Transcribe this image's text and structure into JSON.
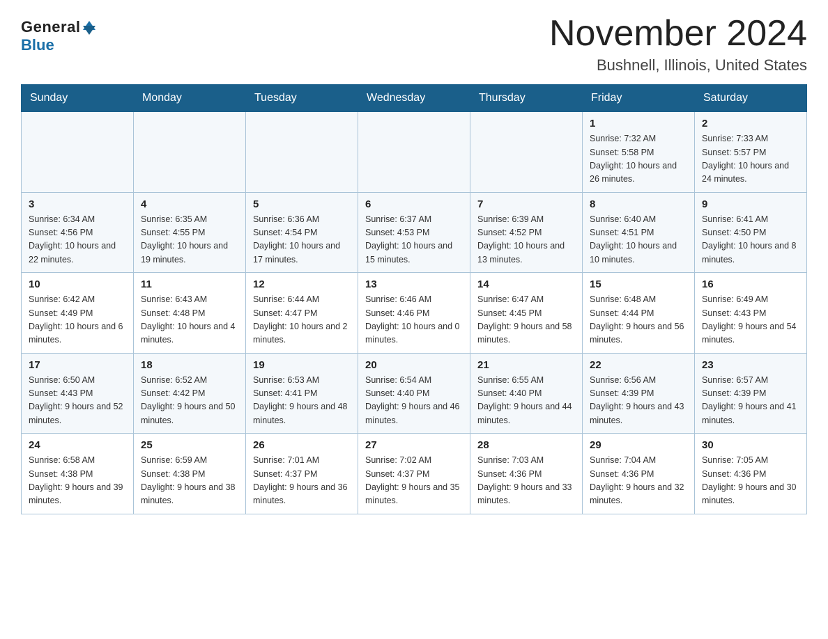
{
  "logo": {
    "general": "General",
    "blue": "Blue"
  },
  "title": "November 2024",
  "location": "Bushnell, Illinois, United States",
  "weekdays": [
    "Sunday",
    "Monday",
    "Tuesday",
    "Wednesday",
    "Thursday",
    "Friday",
    "Saturday"
  ],
  "weeks": [
    [
      {
        "day": "",
        "info": ""
      },
      {
        "day": "",
        "info": ""
      },
      {
        "day": "",
        "info": ""
      },
      {
        "day": "",
        "info": ""
      },
      {
        "day": "",
        "info": ""
      },
      {
        "day": "1",
        "info": "Sunrise: 7:32 AM\nSunset: 5:58 PM\nDaylight: 10 hours and 26 minutes."
      },
      {
        "day": "2",
        "info": "Sunrise: 7:33 AM\nSunset: 5:57 PM\nDaylight: 10 hours and 24 minutes."
      }
    ],
    [
      {
        "day": "3",
        "info": "Sunrise: 6:34 AM\nSunset: 4:56 PM\nDaylight: 10 hours and 22 minutes."
      },
      {
        "day": "4",
        "info": "Sunrise: 6:35 AM\nSunset: 4:55 PM\nDaylight: 10 hours and 19 minutes."
      },
      {
        "day": "5",
        "info": "Sunrise: 6:36 AM\nSunset: 4:54 PM\nDaylight: 10 hours and 17 minutes."
      },
      {
        "day": "6",
        "info": "Sunrise: 6:37 AM\nSunset: 4:53 PM\nDaylight: 10 hours and 15 minutes."
      },
      {
        "day": "7",
        "info": "Sunrise: 6:39 AM\nSunset: 4:52 PM\nDaylight: 10 hours and 13 minutes."
      },
      {
        "day": "8",
        "info": "Sunrise: 6:40 AM\nSunset: 4:51 PM\nDaylight: 10 hours and 10 minutes."
      },
      {
        "day": "9",
        "info": "Sunrise: 6:41 AM\nSunset: 4:50 PM\nDaylight: 10 hours and 8 minutes."
      }
    ],
    [
      {
        "day": "10",
        "info": "Sunrise: 6:42 AM\nSunset: 4:49 PM\nDaylight: 10 hours and 6 minutes."
      },
      {
        "day": "11",
        "info": "Sunrise: 6:43 AM\nSunset: 4:48 PM\nDaylight: 10 hours and 4 minutes."
      },
      {
        "day": "12",
        "info": "Sunrise: 6:44 AM\nSunset: 4:47 PM\nDaylight: 10 hours and 2 minutes."
      },
      {
        "day": "13",
        "info": "Sunrise: 6:46 AM\nSunset: 4:46 PM\nDaylight: 10 hours and 0 minutes."
      },
      {
        "day": "14",
        "info": "Sunrise: 6:47 AM\nSunset: 4:45 PM\nDaylight: 9 hours and 58 minutes."
      },
      {
        "day": "15",
        "info": "Sunrise: 6:48 AM\nSunset: 4:44 PM\nDaylight: 9 hours and 56 minutes."
      },
      {
        "day": "16",
        "info": "Sunrise: 6:49 AM\nSunset: 4:43 PM\nDaylight: 9 hours and 54 minutes."
      }
    ],
    [
      {
        "day": "17",
        "info": "Sunrise: 6:50 AM\nSunset: 4:43 PM\nDaylight: 9 hours and 52 minutes."
      },
      {
        "day": "18",
        "info": "Sunrise: 6:52 AM\nSunset: 4:42 PM\nDaylight: 9 hours and 50 minutes."
      },
      {
        "day": "19",
        "info": "Sunrise: 6:53 AM\nSunset: 4:41 PM\nDaylight: 9 hours and 48 minutes."
      },
      {
        "day": "20",
        "info": "Sunrise: 6:54 AM\nSunset: 4:40 PM\nDaylight: 9 hours and 46 minutes."
      },
      {
        "day": "21",
        "info": "Sunrise: 6:55 AM\nSunset: 4:40 PM\nDaylight: 9 hours and 44 minutes."
      },
      {
        "day": "22",
        "info": "Sunrise: 6:56 AM\nSunset: 4:39 PM\nDaylight: 9 hours and 43 minutes."
      },
      {
        "day": "23",
        "info": "Sunrise: 6:57 AM\nSunset: 4:39 PM\nDaylight: 9 hours and 41 minutes."
      }
    ],
    [
      {
        "day": "24",
        "info": "Sunrise: 6:58 AM\nSunset: 4:38 PM\nDaylight: 9 hours and 39 minutes."
      },
      {
        "day": "25",
        "info": "Sunrise: 6:59 AM\nSunset: 4:38 PM\nDaylight: 9 hours and 38 minutes."
      },
      {
        "day": "26",
        "info": "Sunrise: 7:01 AM\nSunset: 4:37 PM\nDaylight: 9 hours and 36 minutes."
      },
      {
        "day": "27",
        "info": "Sunrise: 7:02 AM\nSunset: 4:37 PM\nDaylight: 9 hours and 35 minutes."
      },
      {
        "day": "28",
        "info": "Sunrise: 7:03 AM\nSunset: 4:36 PM\nDaylight: 9 hours and 33 minutes."
      },
      {
        "day": "29",
        "info": "Sunrise: 7:04 AM\nSunset: 4:36 PM\nDaylight: 9 hours and 32 minutes."
      },
      {
        "day": "30",
        "info": "Sunrise: 7:05 AM\nSunset: 4:36 PM\nDaylight: 9 hours and 30 minutes."
      }
    ]
  ]
}
